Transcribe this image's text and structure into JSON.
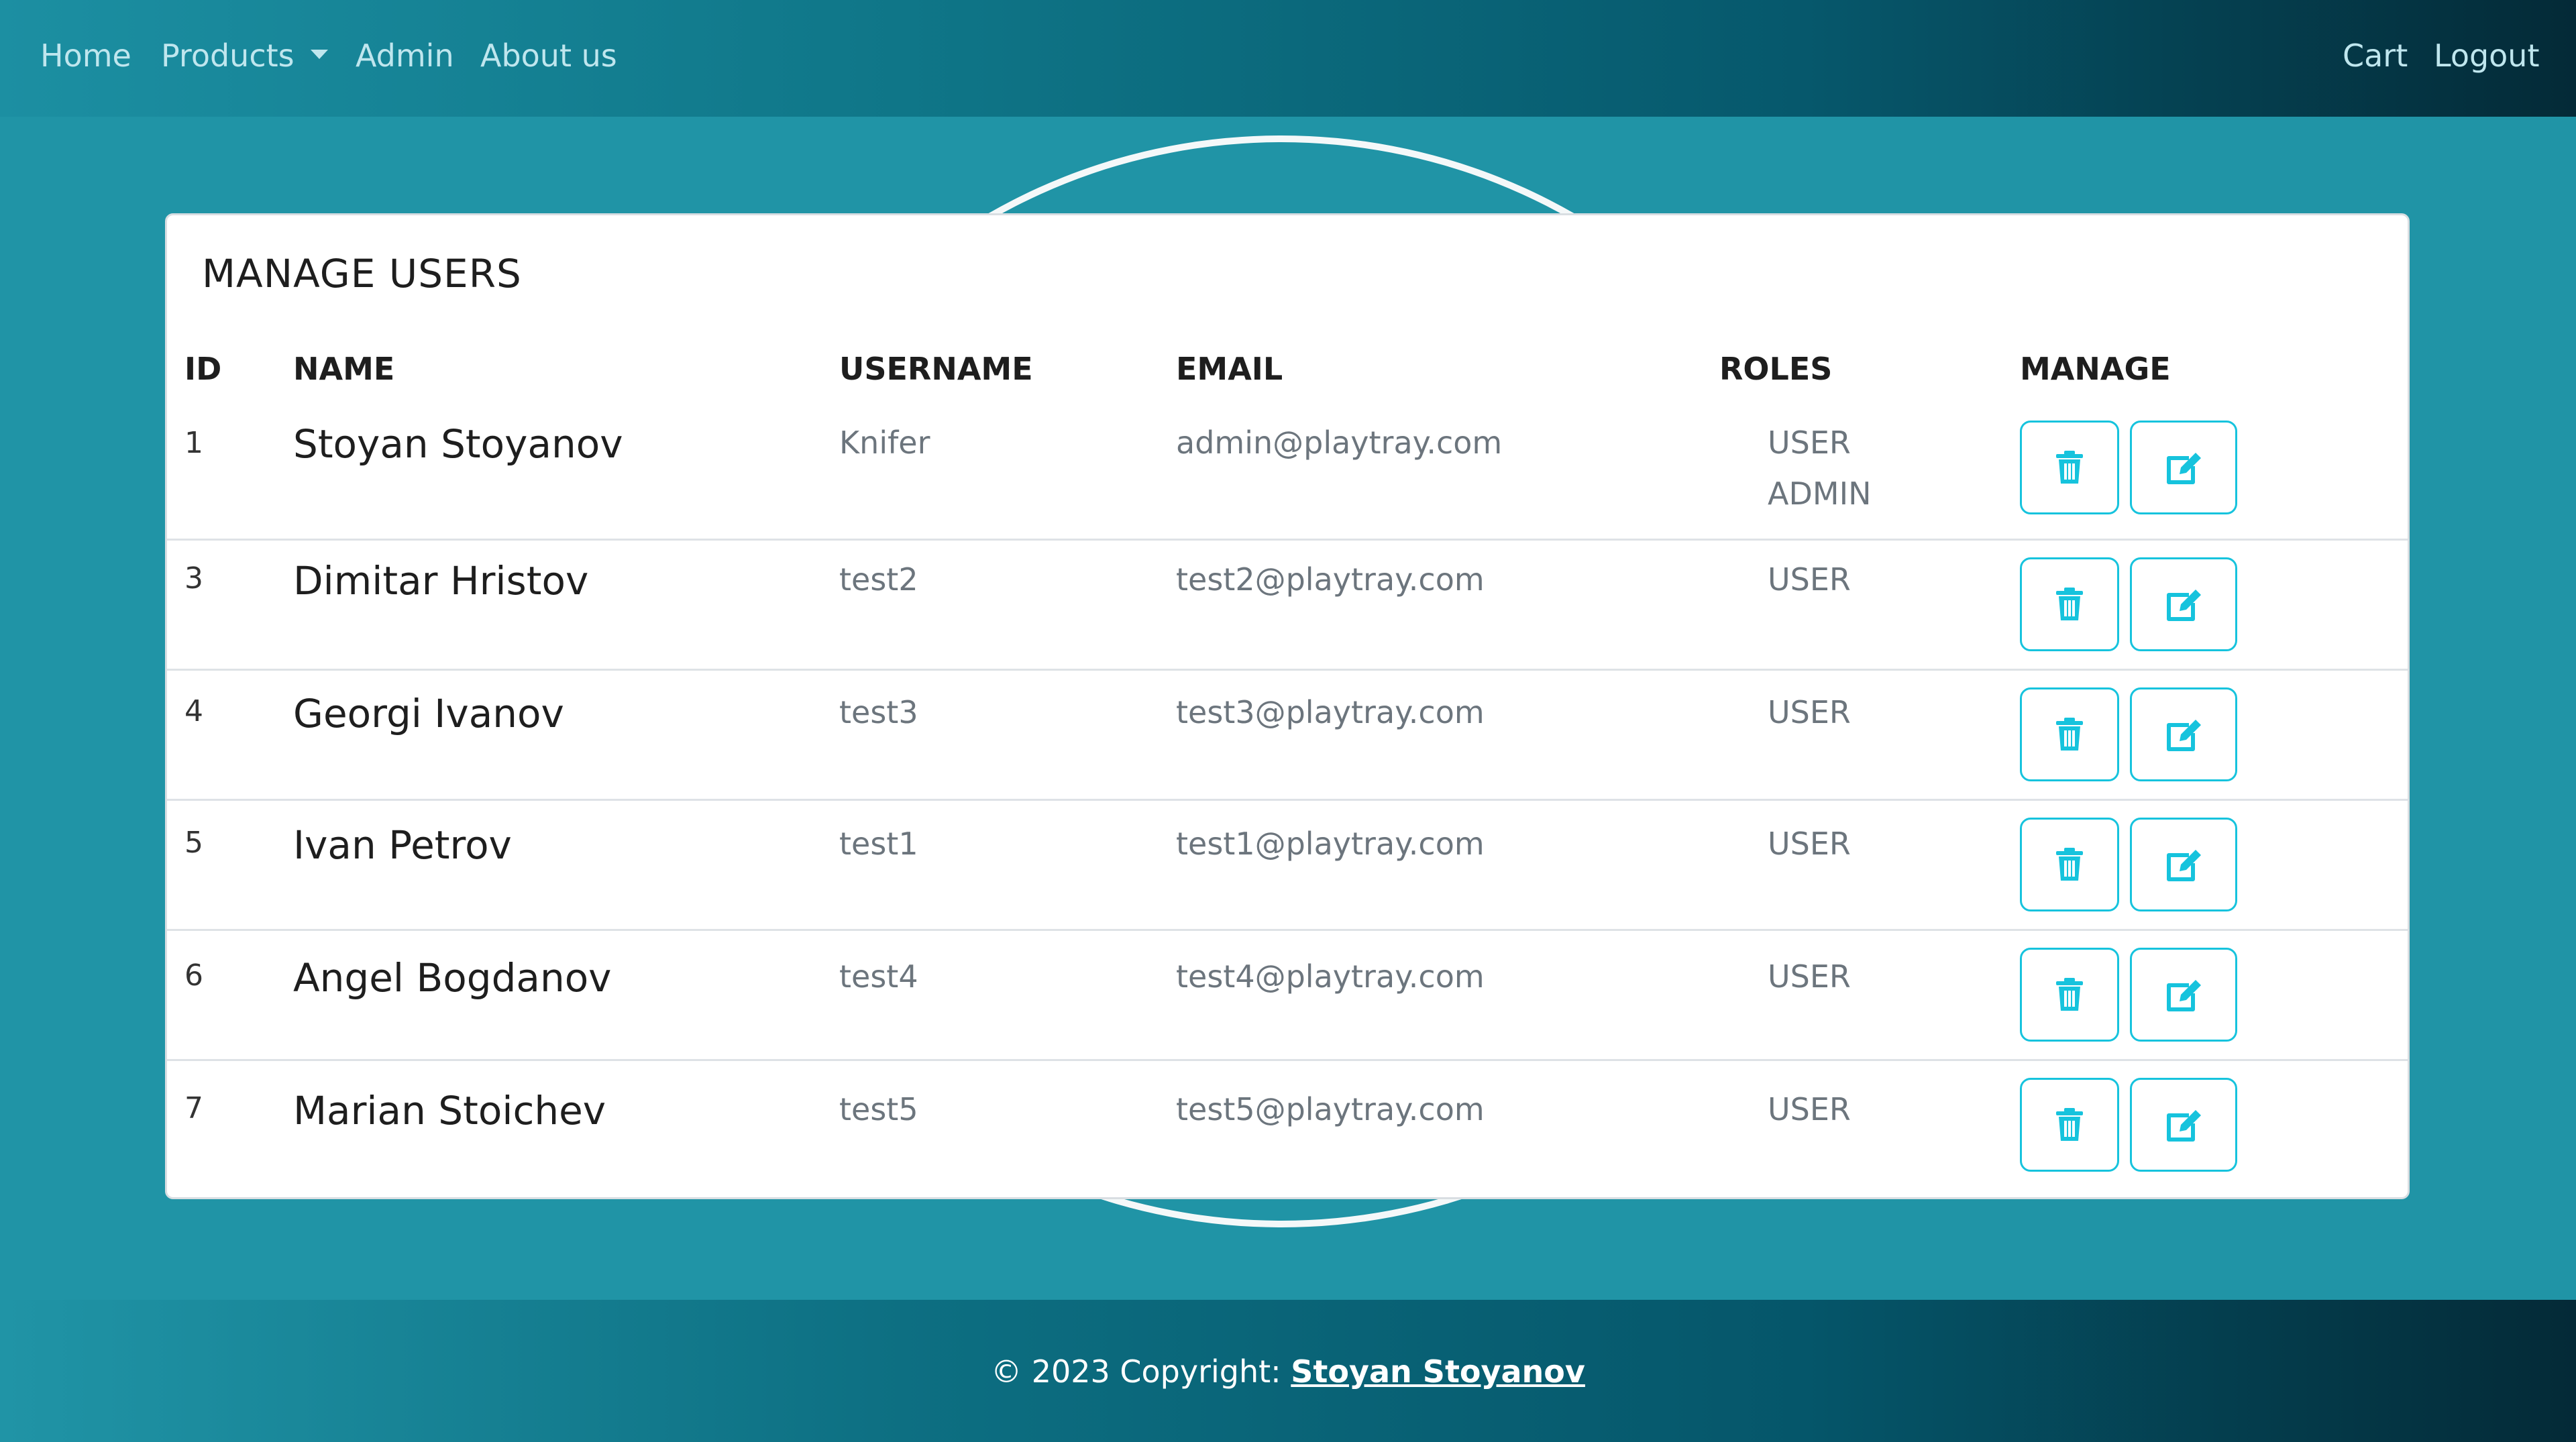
{
  "nav": {
    "home": "Home",
    "products": "Products",
    "admin": "Admin",
    "about": "About us",
    "cart": "Cart",
    "logout": "Logout"
  },
  "page": {
    "title": "MANAGE USERS"
  },
  "table": {
    "headers": {
      "id": "ID",
      "name": "NAME",
      "username": "USERNAME",
      "email": "EMAIL",
      "roles": "ROLES",
      "manage": "MANAGE"
    },
    "rows": [
      {
        "id": "1",
        "name": "Stoyan Stoyanov",
        "username": "Knifer",
        "email": "admin@playtray.com",
        "roles": [
          "USER",
          "ADMIN"
        ]
      },
      {
        "id": "3",
        "name": "Dimitar Hristov",
        "username": "test2",
        "email": "test2@playtray.com",
        "roles": [
          "USER"
        ]
      },
      {
        "id": "4",
        "name": "Georgi Ivanov",
        "username": "test3",
        "email": "test3@playtray.com",
        "roles": [
          "USER"
        ]
      },
      {
        "id": "5",
        "name": "Ivan Petrov",
        "username": "test1",
        "email": "test1@playtray.com",
        "roles": [
          "USER"
        ]
      },
      {
        "id": "6",
        "name": "Angel Bogdanov",
        "username": "test4",
        "email": "test4@playtray.com",
        "roles": [
          "USER"
        ]
      },
      {
        "id": "7",
        "name": "Marian Stoichev",
        "username": "test5",
        "email": "test5@playtray.com",
        "roles": [
          "USER"
        ]
      }
    ],
    "actions": {
      "delete_icon": "trash-icon",
      "edit_icon": "edit-icon"
    }
  },
  "footer": {
    "prefix": "© 2023 Copyright: ",
    "author": "Stoyan Stoyanov"
  },
  "colors": {
    "accent": "#16c3dd",
    "background": "#2094a6",
    "nav_dark": "#042a37"
  }
}
